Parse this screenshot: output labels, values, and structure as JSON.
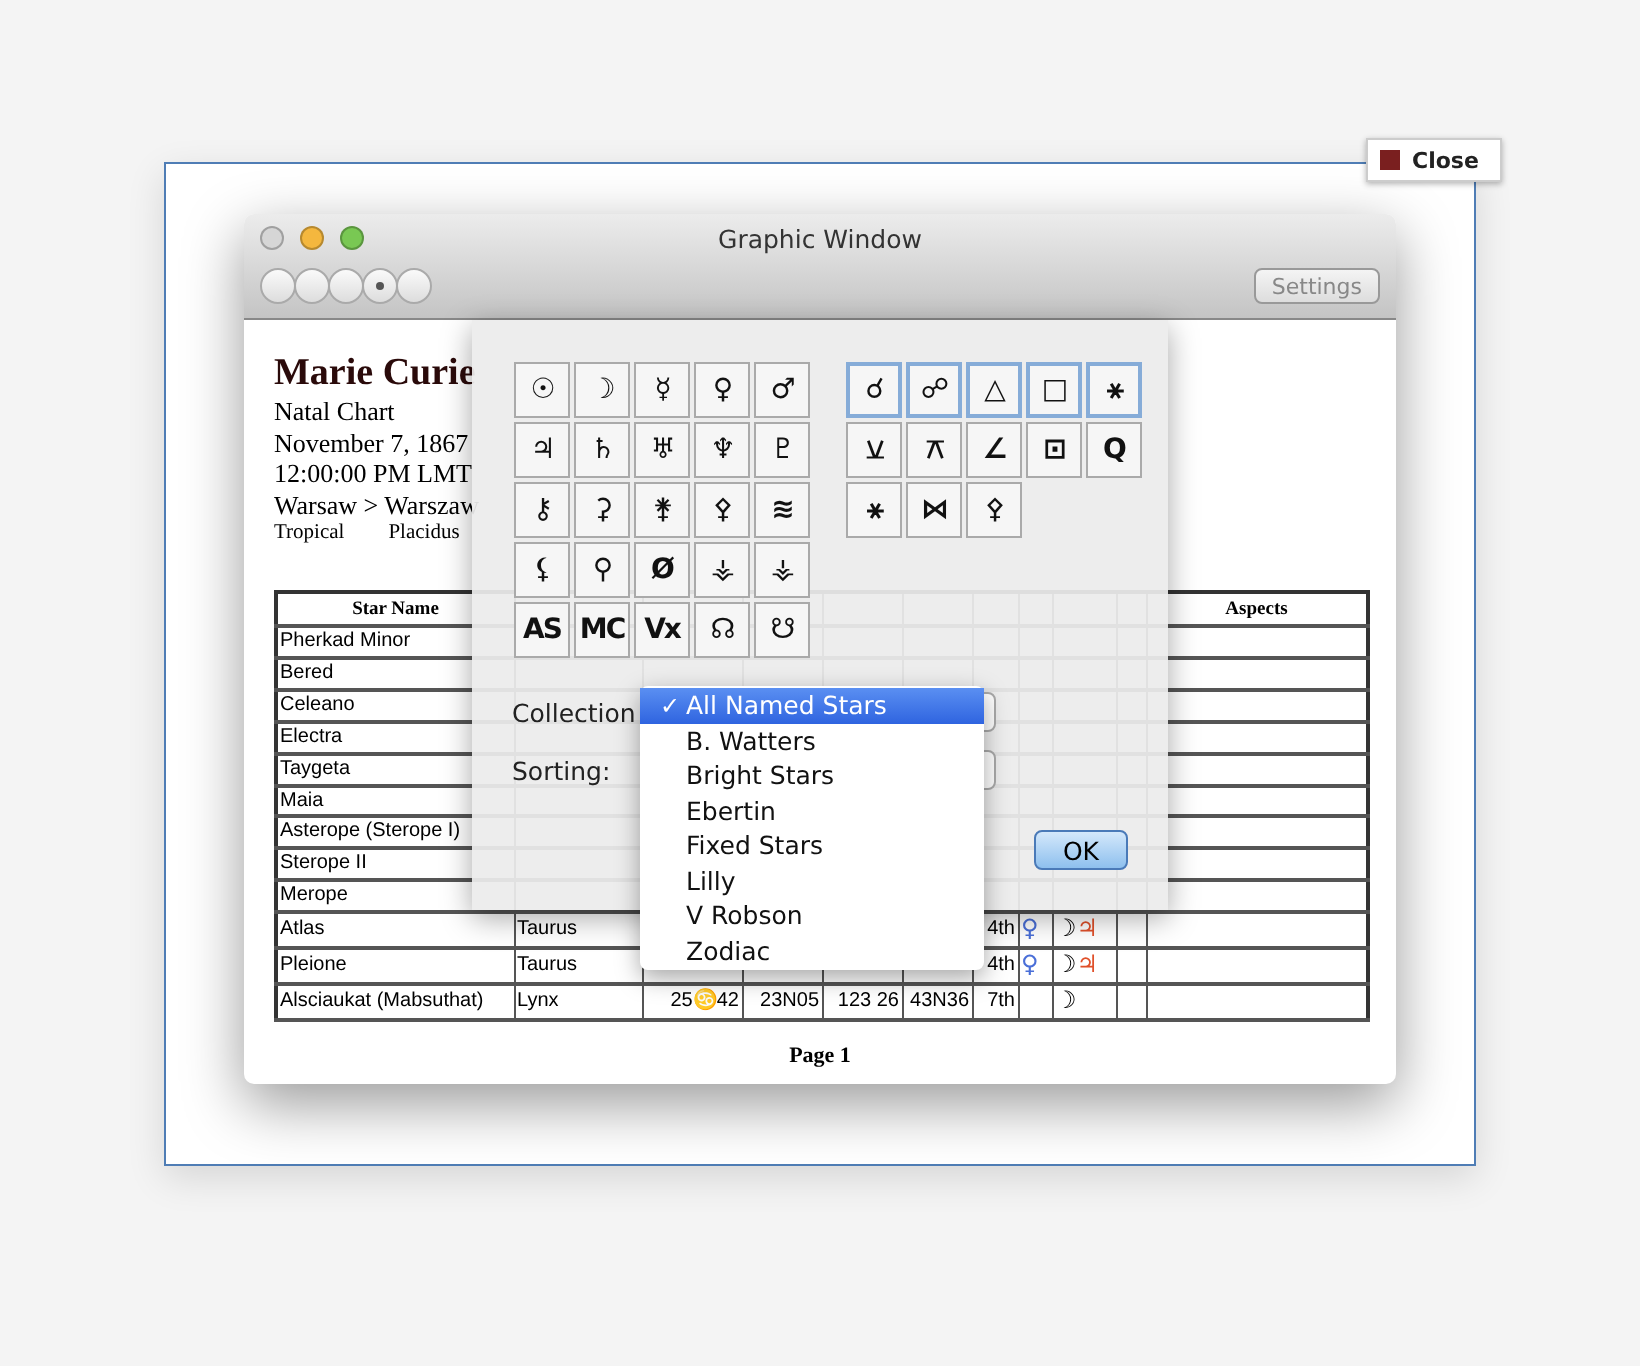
{
  "close_button": {
    "label": "Close"
  },
  "window": {
    "title": "Graphic Window",
    "toolbar": [
      {
        "selected": false
      },
      {
        "selected": false
      },
      {
        "selected": false
      },
      {
        "selected": true
      },
      {
        "selected": false
      }
    ],
    "settings_button": "Settings"
  },
  "chart_header": {
    "name": "Marie Curie",
    "lines": [
      "Natal Chart",
      "November 7, 1867",
      "12:00:00 PM LMT",
      "Warsaw > Warszaw"
    ],
    "zodiac": "Tropical",
    "houses": "Placidus"
  },
  "table": {
    "columns": [
      "Star Name",
      "Aspects"
    ],
    "rows": [
      {
        "name": "Pherkad Minor"
      },
      {
        "name": "Bered"
      },
      {
        "name": "Celeano"
      },
      {
        "name": "Electra"
      },
      {
        "name": "Taygeta"
      },
      {
        "name": "Maia"
      },
      {
        "name": "Asterope (Sterope I)"
      },
      {
        "name": "Sterope II"
      },
      {
        "name": "Merope"
      },
      {
        "name": "Atlas",
        "constellation": "Taurus",
        "house": "4th",
        "planet": {
          "glyph": "♀",
          "color": "#4a6fd8"
        },
        "aspects": [
          {
            "glyph": "☽",
            "color": "#000000"
          },
          {
            "glyph": "♃",
            "color": "#e0502a"
          }
        ]
      },
      {
        "name": "Pleione",
        "constellation": "Taurus",
        "house": "4th",
        "planet": {
          "glyph": "♀",
          "color": "#4a6fd8"
        },
        "aspects": [
          {
            "glyph": "☽",
            "color": "#000000"
          },
          {
            "glyph": "♃",
            "color": "#e0502a"
          }
        ]
      },
      {
        "name": "Alsciaukat (Mabsuthat)",
        "constellation": "Lynx",
        "longitude": "25♋42",
        "latitude": "23N05",
        "ra": "123 26",
        "decl": "43N36",
        "house": "7th",
        "aspects": [
          {
            "glyph": "☽",
            "color": "#000000"
          }
        ]
      }
    ],
    "footer": "Page 1"
  },
  "glyph_panel": {
    "planets": [
      [
        "☉",
        "☽",
        "☿",
        "♀",
        "♂"
      ],
      [
        "♃",
        "♄",
        "♅",
        "♆",
        "♇"
      ],
      [
        "⚷",
        "⚳",
        "⚵",
        "⚴",
        "≋"
      ],
      [
        "⚸",
        "⚲",
        "Ø",
        "⚶",
        "⚶"
      ],
      [
        "AS",
        "MC",
        "Vx",
        "☊",
        "☋"
      ]
    ],
    "aspects": [
      {
        "glyph": "☌",
        "selected": true
      },
      {
        "glyph": "☍",
        "selected": true
      },
      {
        "glyph": "△",
        "selected": true
      },
      {
        "glyph": "□",
        "selected": true
      },
      {
        "glyph": "⚹",
        "selected": true
      },
      {
        "glyph": "⚺",
        "selected": false
      },
      {
        "glyph": "⚻",
        "selected": false
      },
      {
        "glyph": "∠",
        "selected": false
      },
      {
        "glyph": "⊡",
        "selected": false
      },
      {
        "glyph": "Q",
        "selected": false
      },
      {
        "glyph": "⚹",
        "selected": false
      },
      {
        "glyph": "⋈",
        "selected": false
      },
      {
        "glyph": "⚴",
        "selected": false
      }
    ],
    "collection_label": "Collection",
    "sorting_label": "Sorting:",
    "ok_button": "OK"
  },
  "menu_check": "✓",
  "collection_menu": [
    {
      "label": "All Named Stars",
      "selected": true
    },
    {
      "label": "B. Watters",
      "selected": false
    },
    {
      "label": "Bright Stars",
      "selected": false
    },
    {
      "label": "Ebertin",
      "selected": false
    },
    {
      "label": "Fixed Stars",
      "selected": false
    },
    {
      "label": "Lilly",
      "selected": false
    },
    {
      "label": "V Robson",
      "selected": false
    },
    {
      "label": "Zodiac",
      "selected": false
    }
  ]
}
